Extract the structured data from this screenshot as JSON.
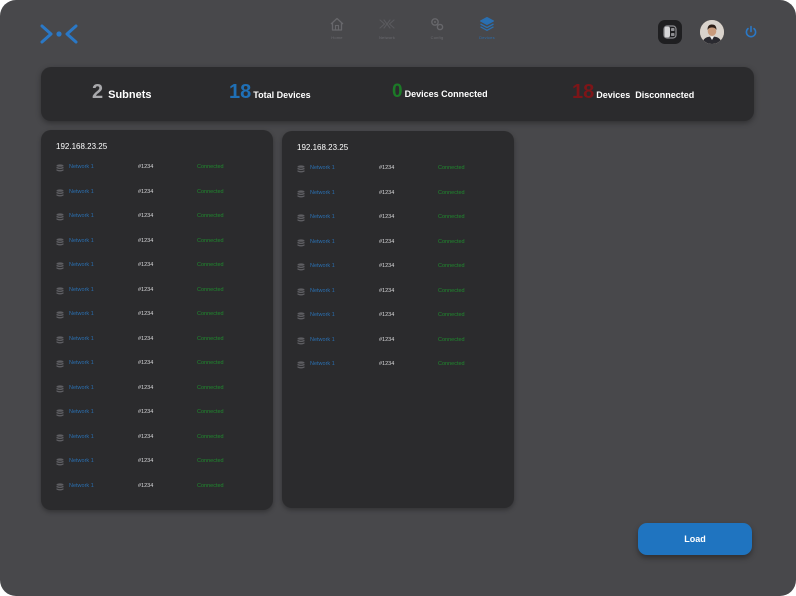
{
  "colors": {
    "background": "#48484b",
    "panel": "#2b2b2d",
    "accent": "#1f74c0",
    "connected": "#1f8a2e",
    "disconnected": "#7d1518"
  },
  "header": {
    "logo_icon": "network-logo-icon",
    "nav": [
      {
        "label": "Home",
        "icon": "home-icon",
        "active": false
      },
      {
        "label": "Network",
        "icon": "network-icon",
        "active": false
      },
      {
        "label": "Config",
        "icon": "settings-icon",
        "active": false
      },
      {
        "label": "Devices",
        "icon": "layers-icon",
        "active": true
      }
    ],
    "right_icons": [
      "theme-toggle-icon",
      "user-avatar",
      "power-icon"
    ]
  },
  "stats": {
    "subnets": {
      "value": "2",
      "label": "Subnets"
    },
    "total": {
      "value": "18",
      "label": "Total Devices"
    },
    "connected": {
      "value": "0",
      "label": "Devices Connected"
    },
    "disconnected": {
      "value": "18",
      "label": "Devices  Disconnected"
    }
  },
  "subnets": [
    {
      "title": "192.168.23.25",
      "rows": [
        {
          "network": "Network 1",
          "id": "#1234",
          "status": "Connected"
        },
        {
          "network": "Network 1",
          "id": "#1234",
          "status": "Connected"
        },
        {
          "network": "Network 1",
          "id": "#1234",
          "status": "Connected"
        },
        {
          "network": "Network 1",
          "id": "#1234",
          "status": "Connected"
        },
        {
          "network": "Network 1",
          "id": "#1234",
          "status": "Connected"
        },
        {
          "network": "Network 1",
          "id": "#1234",
          "status": "Connected"
        },
        {
          "network": "Network 1",
          "id": "#1234",
          "status": "Connected"
        },
        {
          "network": "Network 1",
          "id": "#1234",
          "status": "Connected"
        },
        {
          "network": "Network 1",
          "id": "#1234",
          "status": "Connected"
        },
        {
          "network": "Network 1",
          "id": "#1234",
          "status": "Connected"
        },
        {
          "network": "Network 1",
          "id": "#1234",
          "status": "Connected"
        },
        {
          "network": "Network 1",
          "id": "#1234",
          "status": "Connected"
        },
        {
          "network": "Network 1",
          "id": "#1234",
          "status": "Connected"
        },
        {
          "network": "Network 1",
          "id": "#1234",
          "status": "Connected"
        }
      ]
    },
    {
      "title": "192.168.23.25",
      "rows": [
        {
          "network": "Network 1",
          "id": "#1234",
          "status": "Connected"
        },
        {
          "network": "Network 1",
          "id": "#1234",
          "status": "Connected"
        },
        {
          "network": "Network 1",
          "id": "#1234",
          "status": "Connected"
        },
        {
          "network": "Network 1",
          "id": "#1234",
          "status": "Connected"
        },
        {
          "network": "Network 1",
          "id": "#1234",
          "status": "Connected"
        },
        {
          "network": "Network 1",
          "id": "#1234",
          "status": "Connected"
        },
        {
          "network": "Network 1",
          "id": "#1234",
          "status": "Connected"
        },
        {
          "network": "Network 1",
          "id": "#1234",
          "status": "Connected"
        },
        {
          "network": "Network 1",
          "id": "#1234",
          "status": "Connected"
        }
      ]
    }
  ],
  "actions": {
    "load_label": "Load"
  }
}
